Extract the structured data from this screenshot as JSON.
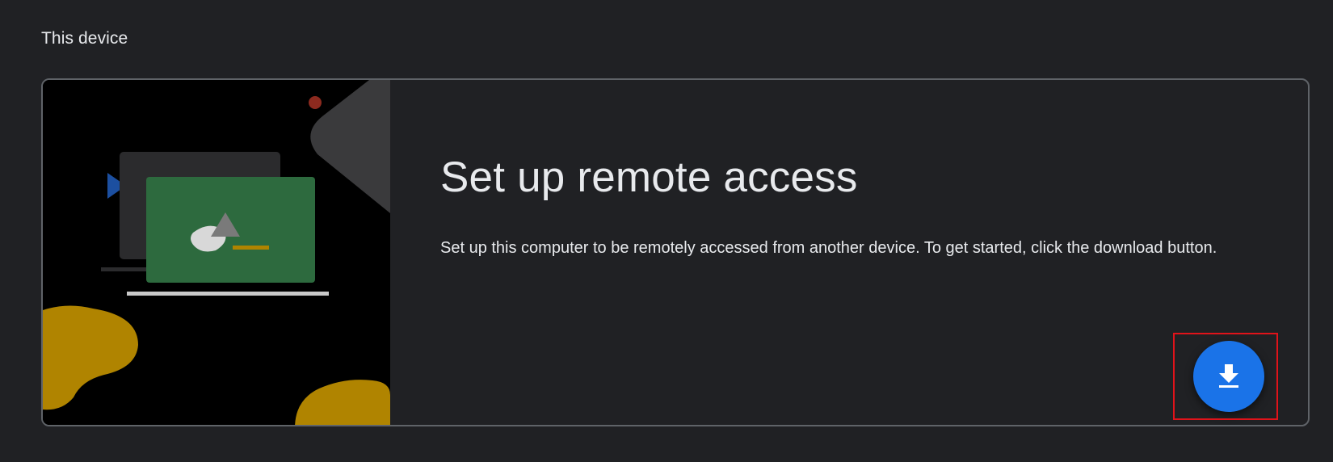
{
  "section": {
    "title": "This device"
  },
  "card": {
    "headline": "Set up remote access",
    "description": "Set up this computer to be remotely accessed from another device. To get started, click the download button.",
    "download_button": {
      "icon": "download-icon",
      "color": "#1a73e8"
    }
  },
  "illustration": {
    "icon": "remote-access-illustration"
  },
  "colors": {
    "background": "#202124",
    "card_border": "#5f6368",
    "accent_blue": "#1a73e8",
    "illustration_green": "#2d6a3e",
    "illustration_gold": "#b08400",
    "highlight_red": "#e0131a"
  }
}
